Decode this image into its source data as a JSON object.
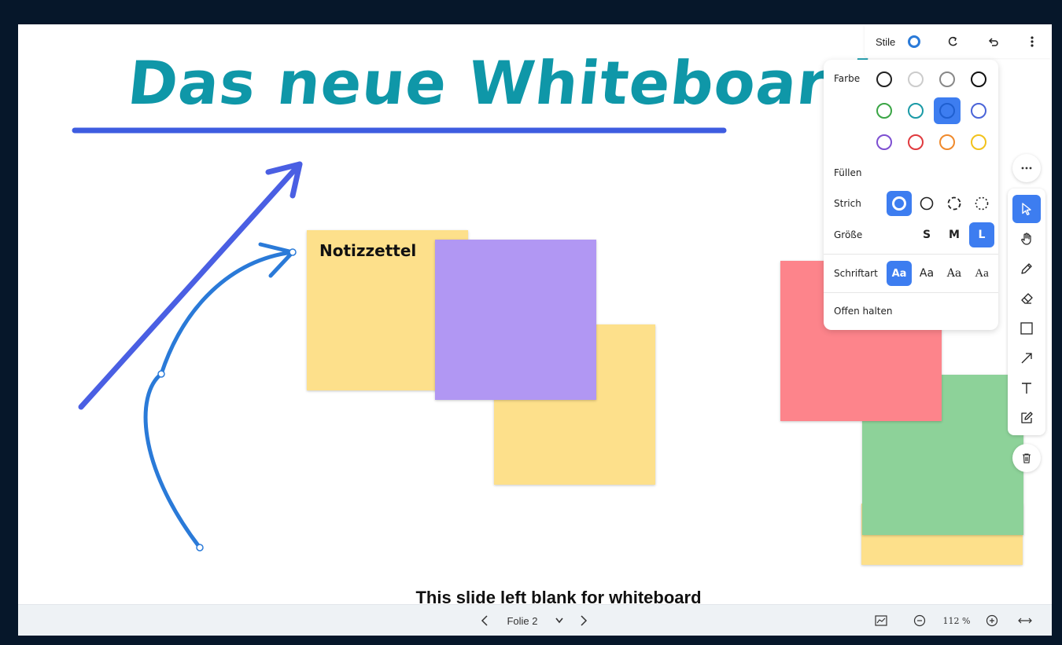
{
  "title": "Das neue Whiteboard",
  "note_label": "Notizzettel",
  "blank_caption": "This slide left blank for whiteboard",
  "colors": {
    "accent": "#3d7df0",
    "title": "#0f97a8",
    "note_yellow": "#fde08b",
    "note_purple": "#b197f3",
    "note_red": "#fd848b",
    "note_green": "#8dd299"
  },
  "style_bar": {
    "label": "Stile",
    "icons": [
      "color-ring-icon",
      "redo-icon",
      "undo-icon",
      "more-vertical-icon"
    ]
  },
  "style_panel": {
    "color_label": "Farbe",
    "fill_label": "Füllen",
    "stroke_label": "Strich",
    "size_label": "Größe",
    "size_options": [
      "S",
      "M",
      "L"
    ],
    "selected_size": "L",
    "font_label": "Schriftart",
    "font_options": [
      "Aa",
      "Aa",
      "Aa",
      "Aa"
    ],
    "keep_open_label": "Offen halten",
    "color_swatches": [
      "#222222",
      "#cccccc",
      "#888888",
      "#111111",
      "#3aa545",
      "#1a9aa6",
      "#3d7df0",
      "#4a64d8",
      "#7d4fd1",
      "#e03a3e",
      "#f08a2c",
      "#f2c21b"
    ],
    "selected_color": "#3d7df0"
  },
  "tools": [
    "select-tool",
    "hand-tool",
    "pencil-tool",
    "eraser-tool",
    "rectangle-tool",
    "arrow-tool",
    "text-tool",
    "note-tool"
  ],
  "selected_tool": "select-tool",
  "bottom_bar": {
    "slide_label": "Folie 2",
    "zoom": "112 %"
  }
}
